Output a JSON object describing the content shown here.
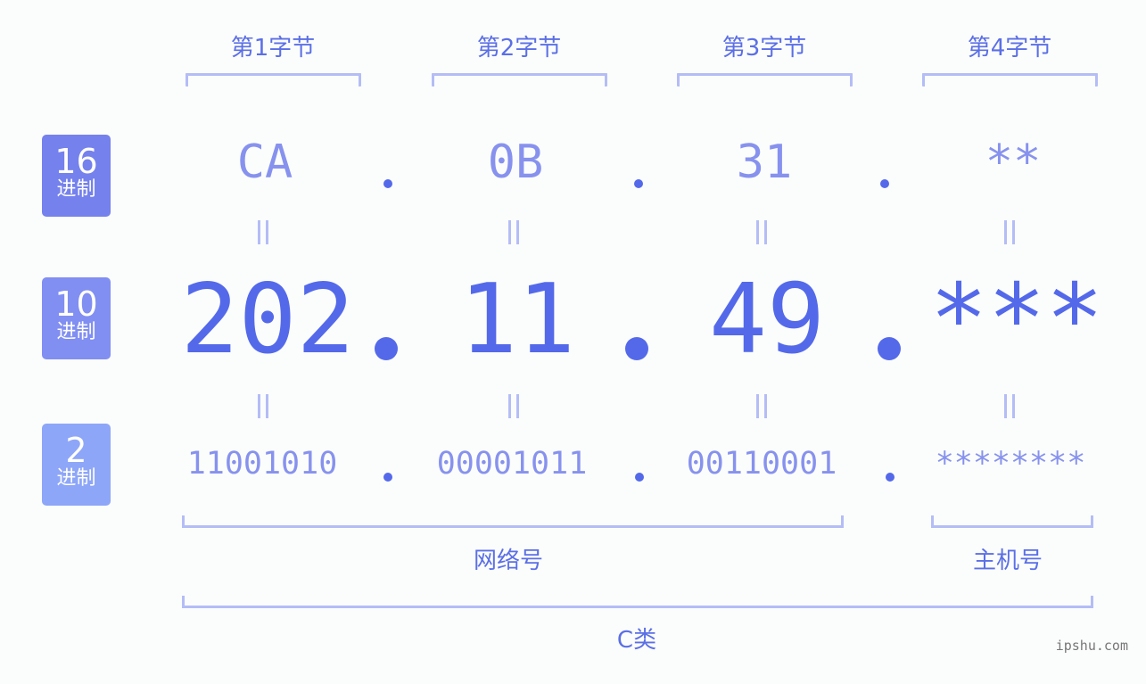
{
  "byte_headers": [
    "第1字节",
    "第2字节",
    "第3字节",
    "第4字节"
  ],
  "rows": {
    "hex": {
      "badge_number": "16",
      "badge_unit": "进制",
      "badge_color": "#7581ec",
      "values": [
        "CA",
        "0B",
        "31",
        "**"
      ]
    },
    "decimal": {
      "badge_number": "10",
      "badge_unit": "进制",
      "badge_color": "#818ff2",
      "values": [
        "202",
        "11",
        "49",
        "***"
      ]
    },
    "binary": {
      "badge_number": "2",
      "badge_unit": "进制",
      "badge_color": "#8ea6f8",
      "values": [
        "11001010",
        "00001011",
        "00110001",
        "********"
      ]
    }
  },
  "equals_symbol": "||",
  "network_label": "网络号",
  "host_label": "主机号",
  "class_label": "C类",
  "watermark": "ipshu.com",
  "colors": {
    "primary": "#5469ea",
    "light_text": "#8792ee",
    "bracket": "#b4bdf6",
    "background": "#fbfdfc"
  }
}
